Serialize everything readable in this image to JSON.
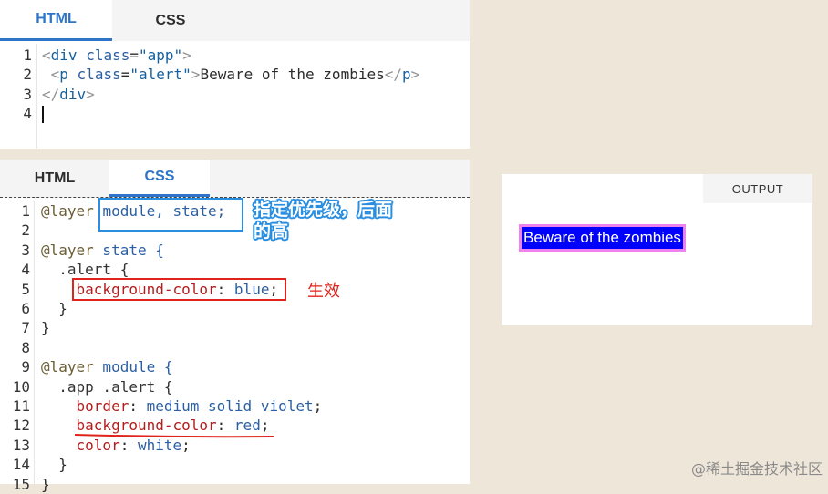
{
  "html_panel": {
    "tabs": [
      "HTML",
      "CSS"
    ],
    "line_numbers": [
      "1",
      "2",
      "3",
      "4"
    ],
    "lines": [
      [
        "<",
        "div",
        " ",
        "class",
        "=",
        "\"app\"",
        ">"
      ],
      [
        " <",
        "p",
        " ",
        "class",
        "=",
        "\"alert\"",
        ">",
        "Beware of the zombies",
        "</",
        "p",
        ">"
      ],
      [
        "</",
        "div",
        ">"
      ]
    ]
  },
  "css_panel": {
    "tabs": [
      "HTML",
      "CSS"
    ],
    "line_numbers": [
      "1",
      "2",
      "3",
      "4",
      "5",
      "6",
      "7",
      "8",
      "9",
      "10",
      "11",
      "12",
      "13",
      "14",
      "15"
    ],
    "lines": [
      [
        "@layer",
        " ",
        "module, state;"
      ],
      [
        ""
      ],
      [
        "@layer",
        " state {"
      ],
      [
        "  .alert {"
      ],
      [
        "    ",
        "background-color",
        ": ",
        "blue",
        ";"
      ],
      [
        "  }"
      ],
      [
        "}"
      ],
      [
        ""
      ],
      [
        "@layer",
        " module {"
      ],
      [
        "  .app .alert {"
      ],
      [
        "    ",
        "border",
        ": ",
        "medium solid violet",
        ";"
      ],
      [
        "    ",
        "background-color",
        ": ",
        "red",
        ";"
      ],
      [
        "    ",
        "color",
        ": ",
        "white",
        ";"
      ],
      [
        "  }"
      ],
      [
        "}"
      ]
    ],
    "annotation_priority": "指定优先级，后面\n的高",
    "annotation_effective": "生效"
  },
  "output_panel": {
    "label": "OUTPUT",
    "alert_text": "Beware of the zombies"
  },
  "watermark": "@稀土掘金技术社区",
  "colors": {
    "tab_active": "#2e74c9",
    "annotation_blue": "#2a8ee0",
    "annotation_red": "#e0231b",
    "alert_bg": "#0000ff",
    "alert_border": "#ee82ee"
  }
}
